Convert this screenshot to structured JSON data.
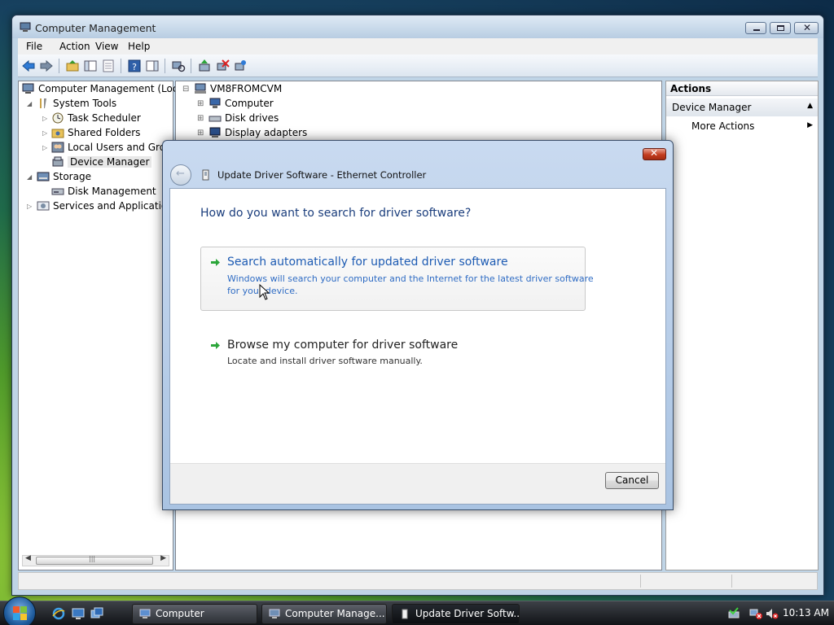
{
  "window": {
    "title": "Computer Management",
    "menu": [
      "File",
      "Action",
      "View",
      "Help"
    ]
  },
  "tree": {
    "items": [
      {
        "label": "Computer Management (Local"
      },
      {
        "label": "System Tools"
      },
      {
        "label": "Task Scheduler"
      },
      {
        "label": "Shared Folders"
      },
      {
        "label": "Local Users and Group"
      },
      {
        "label": "Device Manager"
      },
      {
        "label": "Storage"
      },
      {
        "label": "Disk Management"
      },
      {
        "label": "Services and Applications"
      }
    ],
    "scroll_grip": "|||"
  },
  "devices": {
    "root": "VM8FROMCVM",
    "items": [
      "Computer",
      "Disk drives",
      "Display adapters"
    ]
  },
  "actions": {
    "header": "Actions",
    "section": "Device Manager",
    "more": "More Actions"
  },
  "dialog": {
    "title": "Update Driver Software - Ethernet Controller",
    "question": "How do you want to search for driver software?",
    "option1_title": "Search automatically for updated driver software",
    "option1_desc1": "Windows will search your computer and the Internet for the latest driver software",
    "option1_desc2": "for your device.",
    "option2_title": "Browse my computer for driver software",
    "option2_desc": "Locate and install driver software manually.",
    "cancel": "Cancel"
  },
  "taskbar": {
    "tasks": [
      "Computer",
      "Computer Manage...",
      "Update Driver Softw..."
    ],
    "clock": "10:13 AM"
  },
  "colors": {
    "link_blue": "#1d5bb3",
    "desc_blue": "#2f6cc4",
    "arrow_green": "#2ca63a"
  }
}
